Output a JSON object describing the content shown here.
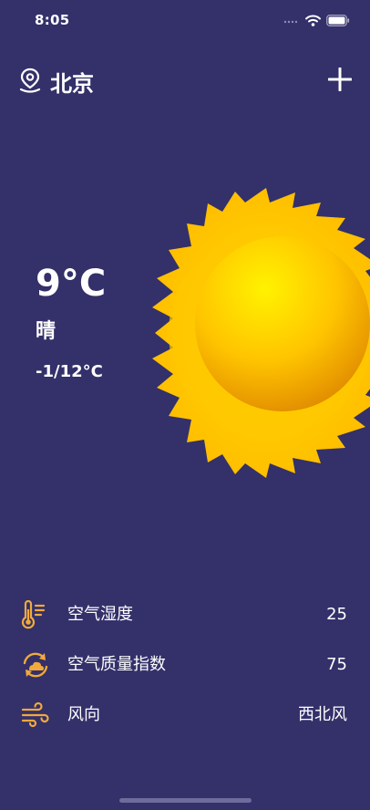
{
  "status_bar": {
    "time": "8:05"
  },
  "header": {
    "city": "北京"
  },
  "weather": {
    "current_temp": "9°C",
    "condition": "晴",
    "range": "-1/12°C"
  },
  "stats": [
    {
      "label": "空气湿度",
      "value": "25",
      "icon": "thermometer-icon"
    },
    {
      "label": "空气质量指数",
      "value": "75",
      "icon": "air-quality-icon"
    },
    {
      "label": "风向",
      "value": "西北风",
      "icon": "wind-icon"
    }
  ],
  "colors": {
    "background": "#33306a",
    "accent": "#f2a93b",
    "sun": "#ffd200"
  }
}
